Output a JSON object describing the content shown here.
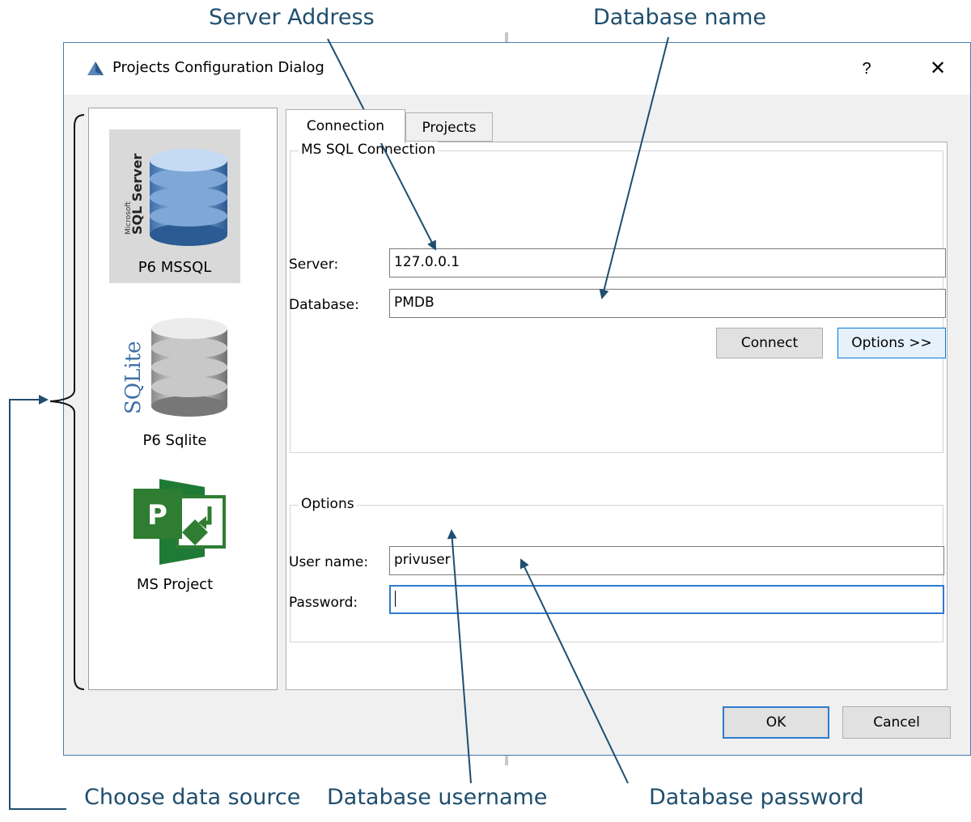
{
  "annotations": {
    "server_address": "Server Address",
    "database_name": "Database name",
    "choose_source": "Choose data source",
    "db_username": "Database username",
    "db_password": "Database password"
  },
  "dialog": {
    "title": "Projects Configuration Dialog",
    "help": "?",
    "close": "✕"
  },
  "sources": [
    {
      "label": "P6 MSSQL",
      "icon": "sql-server-database-icon",
      "selected": true
    },
    {
      "label": "P6 Sqlite",
      "icon": "sqlite-database-icon",
      "selected": false
    },
    {
      "label": "MS Project",
      "icon": "ms-project-icon",
      "selected": false
    }
  ],
  "tabs": [
    {
      "label": "Connection",
      "active": true
    },
    {
      "label": "Projects",
      "active": false
    }
  ],
  "connection_group": {
    "title": "MS SQL Connection",
    "server_label": "Server:",
    "server_value": "127.0.0.1",
    "database_label": "Database:",
    "database_value": "PMDB",
    "connect_button": "Connect",
    "options_button": "Options >>"
  },
  "options_group": {
    "title": "Options",
    "username_label": "User name:",
    "username_value": "privuser",
    "password_label": "Password:",
    "password_value": ""
  },
  "footer": {
    "ok": "OK",
    "cancel": "Cancel"
  },
  "colors": {
    "annotation": "#1f4e6e",
    "accent": "#2e7bcf",
    "msproject_green": "#2e7d32"
  }
}
